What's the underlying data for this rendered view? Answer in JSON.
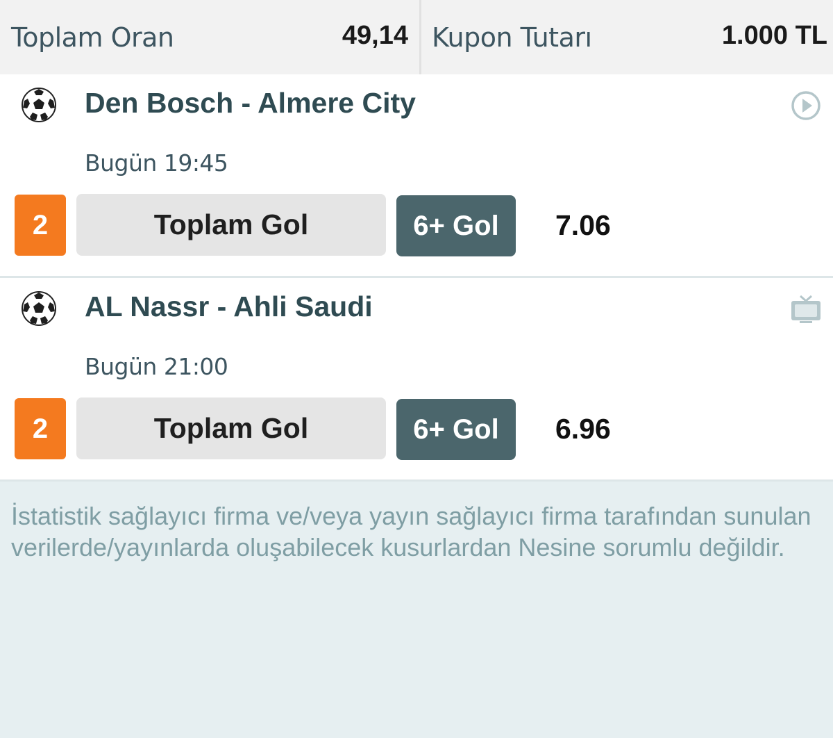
{
  "summary": {
    "total_odds_label": "Toplam Oran",
    "total_odds_value": "49,14",
    "coupon_amount_label": "Kupon Tutarı",
    "coupon_amount_value": "1.000 TL"
  },
  "matches": [
    {
      "sport_icon": "soccer-ball-icon",
      "teams": "Den Bosch - Almere City",
      "time": "Bugün 19:45",
      "status_icon": "play-circle-icon",
      "mbs": "2",
      "market": "Toplam Gol",
      "outcome": "6+ Gol",
      "odd": "7.06"
    },
    {
      "sport_icon": "soccer-ball-icon",
      "teams": "AL Nassr - Ahli Saudi",
      "time": "Bugün 21:00",
      "status_icon": "tv-icon",
      "mbs": "2",
      "market": "Toplam Gol",
      "outcome": "6+ Gol",
      "odd": "6.96"
    }
  ],
  "disclaimer": "İstatistik sağlayıcı firma ve/veya yayın sağlayıcı firma tarafından sunulan verilerde/yayınlarda oluşabilecek kusurlardan Nesine sorumlu değildir.",
  "colors": {
    "mbs_badge": "#f47a1f",
    "outcome_button": "#4b666c",
    "market_button": "#e5e5e5",
    "team_text": "#2f4b52",
    "disclaimer_bg": "#e6eff1"
  }
}
